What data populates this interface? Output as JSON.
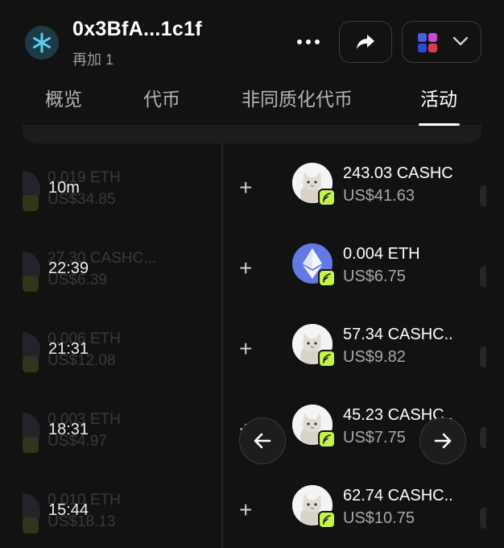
{
  "header": {
    "wallet_name": "0x3BfA...1c1f",
    "wallet_sub": "再加 1",
    "icons": {
      "wallet": "snowflake-icon",
      "more": "more-icon",
      "share": "share-icon",
      "network": "network-grid-icon",
      "chevron": "chevron-down-icon"
    },
    "accent_color": "#c6f24e"
  },
  "tabs": [
    {
      "label": "概览",
      "active": false
    },
    {
      "label": "代币",
      "active": false
    },
    {
      "label": "非同质化代币",
      "active": false
    },
    {
      "label": "活动",
      "active": true
    }
  ],
  "background_list": [
    {
      "amount": "0.019 ETH",
      "value": "US$34.85"
    },
    {
      "amount": "27.30 CASHC...",
      "value": "US$6.39"
    },
    {
      "amount": "0.006 ETH",
      "value": "US$12.08"
    },
    {
      "amount": "0.003 ETH",
      "value": "US$4.97"
    },
    {
      "amount": "0.010 ETH",
      "value": "US$18.13"
    }
  ],
  "activity": [
    {
      "time": "10m",
      "direction": "+",
      "token": "cat",
      "amount": "243.03 CASHC",
      "value": "US$41.63"
    },
    {
      "time": "22:39",
      "direction": "+",
      "token": "eth",
      "amount": "0.004 ETH",
      "value": "US$6.75"
    },
    {
      "time": "21:31",
      "direction": "+",
      "token": "cat",
      "amount": "57.34 CASHC..",
      "value": "US$9.82"
    },
    {
      "time": "18:31",
      "direction": "+",
      "token": "cat",
      "amount": "45.23 CASHC..",
      "value": "US$7.75"
    },
    {
      "time": "15:44",
      "direction": "+",
      "token": "cat",
      "amount": "62.74 CASHC..",
      "value": "US$10.75"
    }
  ]
}
